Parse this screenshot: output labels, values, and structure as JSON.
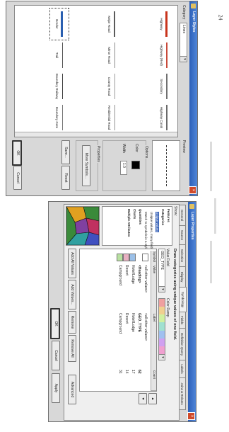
{
  "page_number": "24",
  "window1": {
    "title": "Layer Styles",
    "category_label": "Category",
    "category_value": "Lines",
    "list_label": "Style",
    "preview_label": "Preview",
    "styles": [
      {
        "name": "Highway",
        "color": "#c8341c",
        "thick": 3
      },
      {
        "name": "Highway (Red)",
        "color": "#c84a3a",
        "thick": 2
      },
      {
        "name": "Secondary",
        "color": "#707070",
        "thick": 2
      },
      {
        "name": "Highway Canal",
        "color": "#6a6a6a",
        "thick": 2
      },
      {
        "name": "Major Road",
        "color": "#5a5a5a",
        "thick": 2
      },
      {
        "name": "Minor Road",
        "color": "#8a8a8a",
        "thick": 1
      },
      {
        "name": "County Road",
        "color": "#9a9a9a",
        "thick": 1
      },
      {
        "name": "Residential Road",
        "color": "#909090",
        "thick": 1
      },
      {
        "name": "Border",
        "color": "#2a5fb0",
        "thick": 3
      },
      {
        "name": "Trail",
        "color": "#555555",
        "thick": 1
      },
      {
        "name": "Boundary Railway",
        "color": "#404040",
        "thick": 1
      },
      {
        "name": "Boundary Gate",
        "color": "#777777",
        "thick": 1
      }
    ],
    "options_title": "Options",
    "color_label": "Color",
    "width_label": "Width",
    "width_value": "1.0",
    "properties_title": "Properties",
    "more_symbols_label": "More Symbols...",
    "save_label": "Save...",
    "reset_label": "Reset",
    "ok_label": "OK",
    "cancel_label": "Cancel"
  },
  "window2": {
    "title": "Layer Properties",
    "tabs": [
      "General",
      "Source",
      "Selection",
      "Display",
      "Symbology",
      "Fields",
      "Definition Query",
      "Labels",
      "Joins & Relates"
    ],
    "active_tab": 4,
    "show_label": "Show:",
    "tree": [
      "Features",
      "Categories",
      "Unique values",
      "Unique values, many fields",
      "Match to symbols in a style",
      "Quantities",
      "Charts",
      "Multiple Attributes"
    ],
    "heading": "Draw categories using unique values of one field.",
    "value_field_label": "Value Field",
    "value_field_value": "GEO_TYPE",
    "color_ramp_label": "Color Ramp",
    "columns": [
      "Symbol",
      "Value",
      "Label",
      "Count"
    ],
    "rows": [
      {
        "value": "<all other values>",
        "label": "<all other values>",
        "count": "",
        "color": "#ffffff"
      },
      {
        "value": "<Heading>",
        "label": "GEO_TYPE",
        "count": "62",
        "color": ""
      },
      {
        "value": "Hotel/Lodge",
        "label": "Hotel/Lodge",
        "count": "17",
        "color": "#9bc0e8"
      },
      {
        "value": "Resort",
        "label": "Resort",
        "count": "14",
        "color": "#e8b0c0"
      },
      {
        "value": "Campground",
        "label": "Campground",
        "count": "31",
        "color": "#b8e0a0"
      }
    ],
    "ramp_colors": [
      "#f0a0a0",
      "#f0d090",
      "#d0f0a0",
      "#a0e0d0",
      "#a0c0f0",
      "#d0a0f0",
      "#f0a0d0"
    ],
    "add_all_values_label": "Add All Values",
    "add_values_label": "Add Values...",
    "remove_label": "Remove",
    "remove_all_label": "Remove All",
    "advanced_label": "Advanced",
    "ok_label": "OK",
    "cancel_label": "Cancel",
    "apply_label": "Apply",
    "thumb_colors": [
      "#3a8a3a",
      "#c03060",
      "#4050c0",
      "#e0a020",
      "#8040a0",
      "#30a0a0"
    ]
  }
}
